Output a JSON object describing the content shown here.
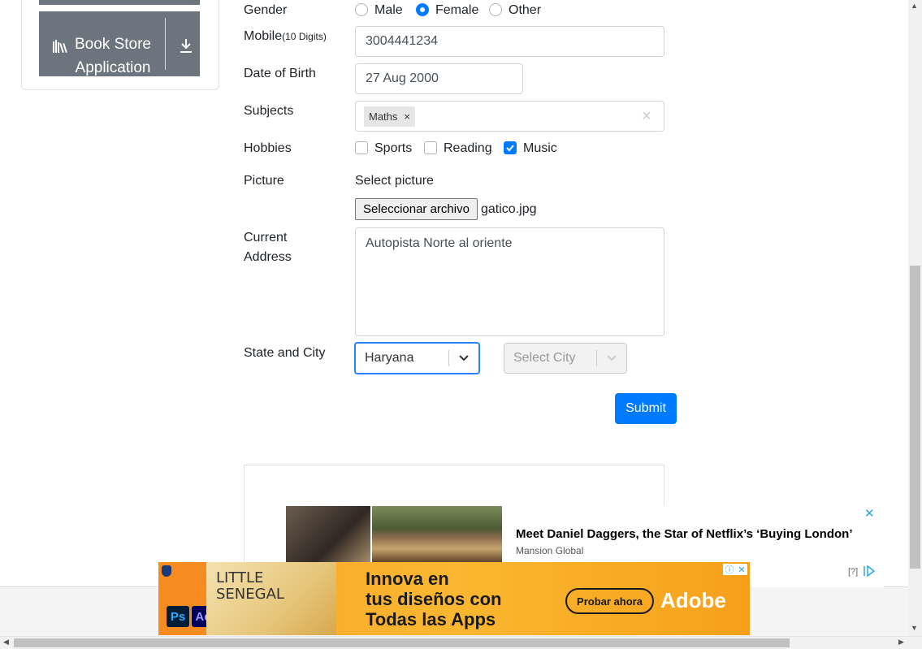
{
  "sidebar": {
    "item_label": "Book Store Application",
    "item_icon": "book-shelf-icon",
    "action_icon": "download-icon"
  },
  "form": {
    "gender": {
      "label": "Gender",
      "options": [
        "Male",
        "Female",
        "Other"
      ],
      "selected": "Female"
    },
    "mobile": {
      "label": "Mobile",
      "hint": "(10 Digits)",
      "value": "3004441234"
    },
    "dob": {
      "label": "Date of Birth",
      "value": "27 Aug 2000"
    },
    "subjects": {
      "label": "Subjects",
      "chips": [
        "Maths"
      ],
      "chip_remove": "×",
      "clear": "×"
    },
    "hobbies": {
      "label": "Hobbies",
      "options": [
        {
          "label": "Sports",
          "checked": false
        },
        {
          "label": "Reading",
          "checked": false
        },
        {
          "label": "Music",
          "checked": true
        }
      ]
    },
    "picture": {
      "label": "Picture",
      "hint": "Select picture",
      "button": "Seleccionar archivo",
      "file": "gatico.jpg"
    },
    "address": {
      "label_line1": "Current",
      "label_line2": "Address",
      "value": "Autopista Norte al oriente"
    },
    "state_city": {
      "label": "State and City",
      "state": "Haryana",
      "city_placeholder": "Select City"
    },
    "submit": "Submit"
  },
  "ads": {
    "article": {
      "title": "Meet Daniel Daggers, the Star of Netflix’s ‘Buying London’",
      "source": "Mansion Global",
      "close": "✕",
      "help": "[?]"
    },
    "banner": {
      "poster_line1": "LITTLE",
      "poster_line2": "SENEGAL",
      "app1": "Ps",
      "app2": "Ae",
      "headline_1": "Innova en",
      "headline_2": "tus diseños con",
      "headline_3": "Todas las Apps",
      "cta": "Probar ahora",
      "brand": "Adobe"
    }
  },
  "colors": {
    "primary": "#007bff",
    "sidebar": "#6c757d",
    "ad_orange": "#fbb731"
  }
}
